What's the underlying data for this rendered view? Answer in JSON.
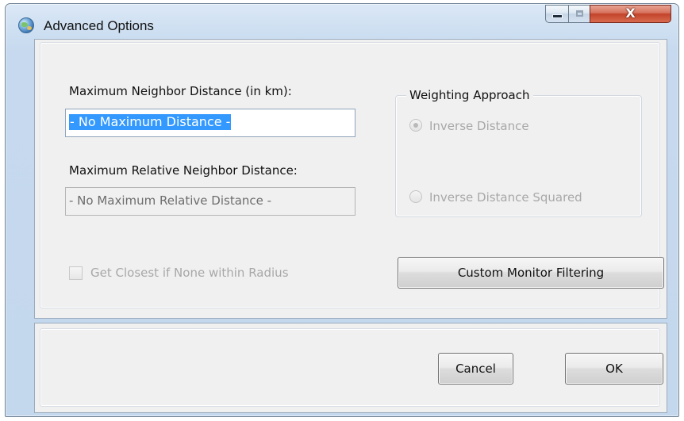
{
  "window": {
    "title": "Advanced Options",
    "icon": "globe-icon",
    "close_glyph": "X"
  },
  "max_neighbor": {
    "label": "Maximum Neighbor Distance (in km):",
    "value": "- No Maximum Distance -"
  },
  "max_relative": {
    "label": "Maximum Relative Neighbor Distance:",
    "value": "- No Maximum Relative Distance -"
  },
  "weighting": {
    "legend": "Weighting Approach",
    "options": [
      {
        "label": "Inverse Distance",
        "selected": true
      },
      {
        "label": "Inverse Distance Squared",
        "selected": false
      }
    ]
  },
  "closest": {
    "label": "Get Closest if None within Radius",
    "checked": false
  },
  "buttons": {
    "custom_filter": "Custom Monitor Filtering",
    "cancel": "Cancel",
    "ok": "OK"
  }
}
